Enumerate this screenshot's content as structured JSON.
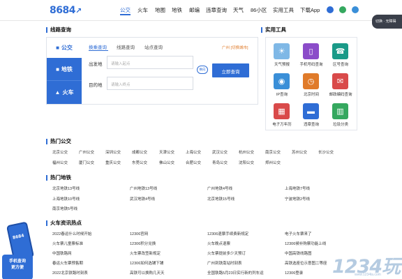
{
  "header": {
    "logo": "8684",
    "nav": [
      "公交",
      "火车",
      "地图",
      "地铁",
      "邮编",
      "违章查询",
      "天气",
      "86小区",
      "实用工具",
      "下载App"
    ],
    "active_nav": "公交"
  },
  "float_tab": {
    "label": "切换 · 无障碍"
  },
  "route": {
    "title": "线路查询",
    "modes": [
      "公交",
      "地铁",
      "火车"
    ],
    "tabs": [
      "换乘查询",
      "线路查询",
      "站点查询"
    ],
    "city_link": "广州 [切换城市]",
    "from_label": "出发地",
    "from_placeholder": "请输入起点",
    "to_label": "目的地",
    "to_placeholder": "请输入终点",
    "swap_label": "换向",
    "query_button": "立即查询"
  },
  "tools": {
    "title": "实用工具",
    "items": [
      {
        "name": "天气预报",
        "icon": "weather-icon",
        "color": "#7fb8e6"
      },
      {
        "name": "手机号码查询",
        "icon": "phone-icon",
        "color": "#8b4cc9"
      },
      {
        "name": "区号查询",
        "icon": "telephone-icon",
        "color": "#1a9a88"
      },
      {
        "name": "IP查询",
        "icon": "ip-icon",
        "color": "#3a8fd8"
      },
      {
        "name": "北京时间",
        "icon": "clock-icon",
        "color": "#e07b2a"
      },
      {
        "name": "邮政编码查询",
        "icon": "mail-icon",
        "color": "#d94a4a"
      },
      {
        "name": "电子万年历",
        "icon": "calendar-icon",
        "color": "#d94a4a"
      },
      {
        "name": "违章查询",
        "icon": "car-icon",
        "color": "#2f6dd5"
      },
      {
        "name": "垃圾分类",
        "icon": "trash-icon",
        "color": "#35a85f"
      }
    ]
  },
  "hot_bus": {
    "title": "热门公交",
    "links": [
      "北京公交",
      "广州公交",
      "深圳公交",
      "成都公交",
      "天津公交",
      "上海公交",
      "武汉公交",
      "杭州公交",
      "南京公交",
      "苏州公交",
      "长沙公交",
      "福州公交",
      "厦门公交",
      "重庆公交",
      "东莞公交",
      "佛山公交",
      "合肥公交",
      "青岛公交",
      "沈阳公交",
      "郑州公交"
    ]
  },
  "hot_metro": {
    "title": "热门地铁",
    "links": [
      "北京地铁13号线",
      "广州地铁13号线",
      "广州地铁4号线",
      "上海地铁7号线",
      "上海地铁10号线",
      "武汉地铁4号线",
      "北京地铁15号线",
      "宁波地铁2号线",
      "南京地铁5号线"
    ]
  },
  "train_news": {
    "title": "火车资讯热点",
    "links": [
      "2022春运什么时候开始",
      "12306官网",
      "12306退票手续费新规定",
      "电子火车票来了",
      "火车票儿童票标准",
      "12306积分兑换",
      "火车晚点退票",
      "12306候补购票功能上线",
      "中国铁路网",
      "火车票改签新规定",
      "火车票提前多少天预订",
      "中国高铁线路图",
      "春运火车票预售期",
      "12306如何选铺下铺",
      "广州到铁南站时刻表",
      "高铁选座位示意图二等座",
      "2022北京铁路时刻表",
      "高铁可以换购几天天",
      "全国铁路5月23日实行新的列车运",
      "12306登录"
    ]
  },
  "promo": {
    "phone_text": "8684",
    "badge_line1": "手机查询",
    "badge_line2": "更方便"
  },
  "watermark": {
    "big": "1234玩",
    "small": "www.1234la.com"
  }
}
